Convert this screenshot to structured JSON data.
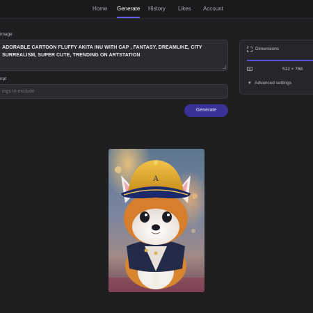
{
  "nav": {
    "items": [
      {
        "label": "Home",
        "active": false
      },
      {
        "label": "Generate",
        "active": true
      },
      {
        "label": "History",
        "active": false
      },
      {
        "label": "Likes",
        "active": false
      },
      {
        "label": "Account",
        "active": false
      }
    ]
  },
  "prompt": {
    "label": "image",
    "value": "ADORABLE CARTOON FLUFFY AKITA INU WITH CAP , FANTASY, DREAMLIKE, CITY SURREALISM, SUPER CUTE, TRENDING ON ARTSTATION"
  },
  "negative_prompt": {
    "label": "npt",
    "placeholder": "ings to exclude"
  },
  "generate_button": {
    "label": "Generate"
  },
  "settings": {
    "dimensions_label": "Dimensions",
    "dimensions_value": "512 × 768",
    "advanced_label": "Advanced settings"
  },
  "result_image": {
    "cap_letter": "A"
  },
  "colors": {
    "background": "#1f1f22",
    "accent": "#6b5cf6",
    "button": "#3a3296"
  }
}
